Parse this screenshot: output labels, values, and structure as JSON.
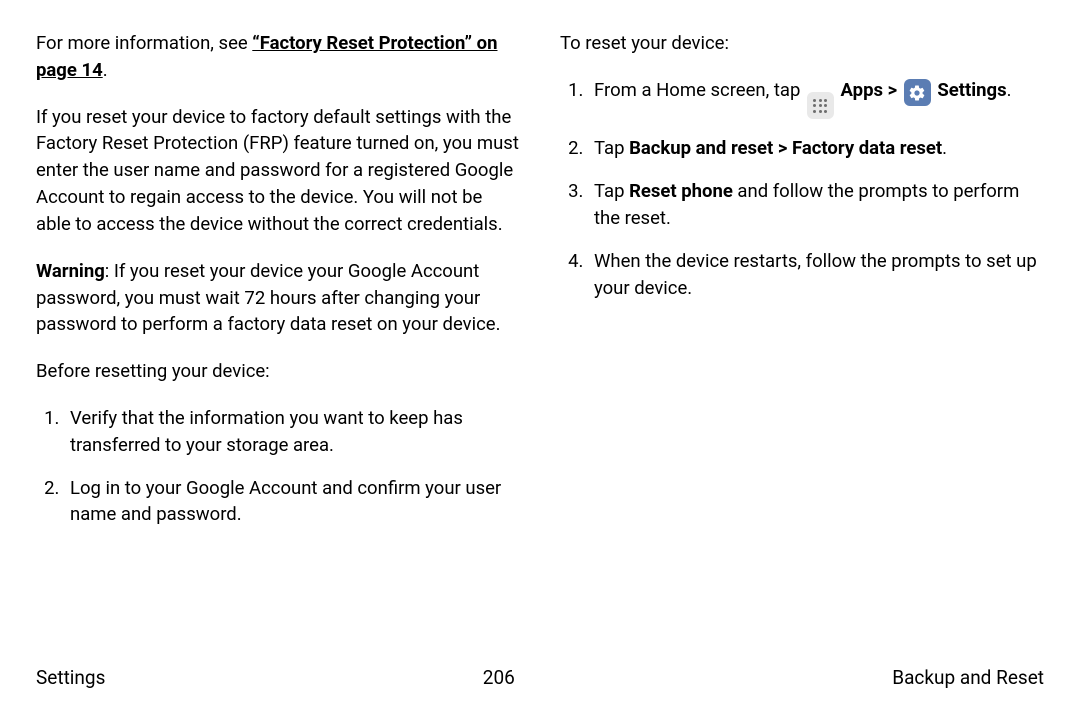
{
  "left": {
    "intro_prefix": "For more information, see ",
    "intro_link": "“Factory Reset Protection” on page 14",
    "intro_suffix": ".",
    "para1": "If you reset your device to factory default settings with the Factory Reset Protection (FRP) feature turned on, you must enter the user name and password for a registered Google Account to regain access to the device. You will not be able to access the device without the correct credentials.",
    "warn_label": "Warning",
    "warn_text": ": If you reset your device your Google Account password, you must wait 72 hours after changing your password to perform a factory data reset on your device.",
    "before_heading": "Before resetting your device:",
    "before_steps": [
      "Verify that the information you want to keep has transferred to your storage area.",
      "Log in to your Google Account and confirm your user name and password."
    ]
  },
  "right": {
    "reset_heading": "To reset your device:",
    "step1_prefix": "From a Home screen, tap ",
    "apps_label": "Apps",
    "chev": " > ",
    "settings_label": "Settings",
    "step1_suffix": ".",
    "step2_prefix": "Tap ",
    "step2_bold": "Backup and reset > Factory data reset",
    "step2_suffix": ".",
    "step3_prefix": "Tap ",
    "step3_bold": "Reset phone",
    "step3_suffix": " and follow the prompts to perform the reset.",
    "step4": "When the device restarts, follow the prompts to set up your device."
  },
  "footer": {
    "left": "Settings",
    "center": "206",
    "right": "Backup and Reset"
  }
}
